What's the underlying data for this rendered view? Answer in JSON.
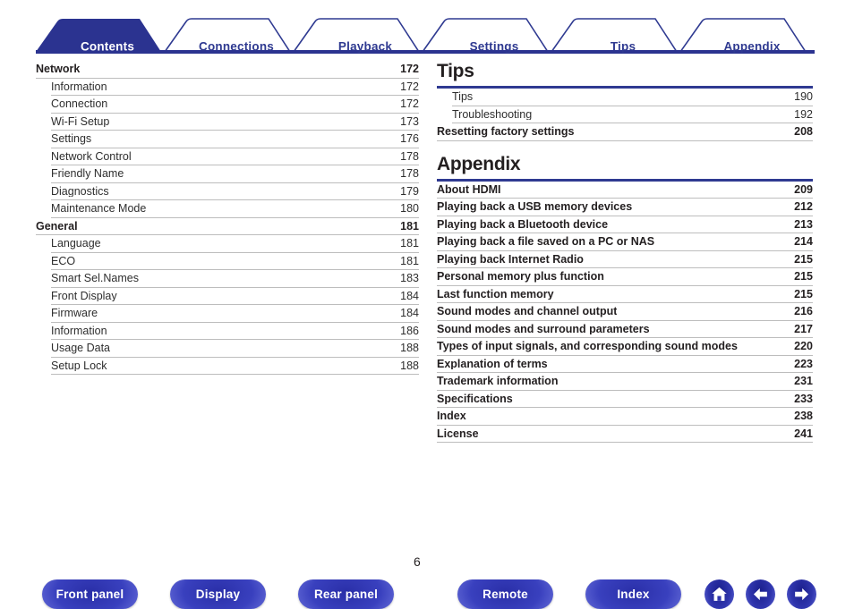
{
  "document": {
    "page_number": "6"
  },
  "tabs": [
    {
      "label": "Contents",
      "active": true
    },
    {
      "label": "Connections",
      "active": false
    },
    {
      "label": "Playback",
      "active": false
    },
    {
      "label": "Settings",
      "active": false
    },
    {
      "label": "Tips",
      "active": false
    },
    {
      "label": "Appendix",
      "active": false
    }
  ],
  "colors": {
    "brand_blue": "#2f3a91",
    "active_tab_fill": "#2b3390",
    "rule_gray": "#bdbdbd",
    "text": "#231f20"
  },
  "left_column": {
    "groups": [
      {
        "heading": {
          "title": "Network",
          "page": "172"
        },
        "items": [
          {
            "title": "Information",
            "page": "172"
          },
          {
            "title": "Connection",
            "page": "172"
          },
          {
            "title": "Wi-Fi Setup",
            "page": "173"
          },
          {
            "title": "Settings",
            "page": "176"
          },
          {
            "title": "Network Control",
            "page": "178"
          },
          {
            "title": "Friendly Name",
            "page": "178"
          },
          {
            "title": "Diagnostics",
            "page": "179"
          },
          {
            "title": "Maintenance Mode",
            "page": "180"
          }
        ]
      },
      {
        "heading": {
          "title": "General",
          "page": "181"
        },
        "items": [
          {
            "title": "Language",
            "page": "181"
          },
          {
            "title": "ECO",
            "page": "181"
          },
          {
            "title": "Smart Sel.Names",
            "page": "183"
          },
          {
            "title": "Front Display",
            "page": "184"
          },
          {
            "title": "Firmware",
            "page": "184"
          },
          {
            "title": "Information",
            "page": "186"
          },
          {
            "title": "Usage Data",
            "page": "188"
          },
          {
            "title": "Setup Lock",
            "page": "188"
          }
        ]
      }
    ]
  },
  "right_column": {
    "sections": [
      {
        "title": "Tips",
        "sub_items": [
          {
            "title": "Tips",
            "page": "190"
          },
          {
            "title": "Troubleshooting",
            "page": "192"
          }
        ],
        "top_items": [
          {
            "title": "Resetting factory settings",
            "page": "208"
          }
        ]
      },
      {
        "title": "Appendix",
        "sub_items": [],
        "top_items": [
          {
            "title": "About HDMI",
            "page": "209"
          },
          {
            "title": "Playing back a USB memory devices",
            "page": "212"
          },
          {
            "title": "Playing back a Bluetooth device",
            "page": "213"
          },
          {
            "title": "Playing back a file saved on a PC or NAS",
            "page": "214"
          },
          {
            "title": "Playing back Internet Radio",
            "page": "215"
          },
          {
            "title": "Personal memory plus function",
            "page": "215"
          },
          {
            "title": "Last function memory",
            "page": "215"
          },
          {
            "title": "Sound modes and channel output",
            "page": "216"
          },
          {
            "title": "Sound modes and surround parameters",
            "page": "217"
          },
          {
            "title": "Types of input signals, and corresponding sound modes",
            "page": "220"
          },
          {
            "title": "Explanation of terms",
            "page": "223"
          },
          {
            "title": "Trademark information",
            "page": "231"
          },
          {
            "title": "Specifications",
            "page": "233"
          },
          {
            "title": "Index",
            "page": "238"
          },
          {
            "title": "License",
            "page": "241"
          }
        ]
      }
    ]
  },
  "footer": {
    "buttons": [
      {
        "label": "Front panel",
        "name": "front-panel-button"
      },
      {
        "label": "Display",
        "name": "display-button"
      },
      {
        "label": "Rear panel",
        "name": "rear-panel-button"
      },
      {
        "label": "Remote",
        "name": "remote-button"
      },
      {
        "label": "Index",
        "name": "index-button"
      }
    ],
    "icons": [
      {
        "name": "home-icon"
      },
      {
        "name": "arrow-left-icon"
      },
      {
        "name": "arrow-right-icon"
      }
    ]
  }
}
